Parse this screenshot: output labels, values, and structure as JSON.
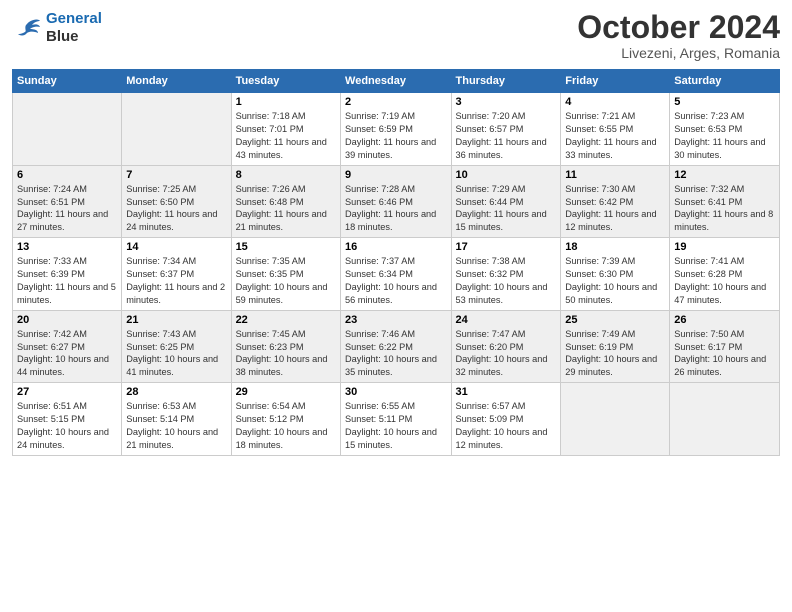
{
  "header": {
    "logo_line1": "General",
    "logo_line2": "Blue",
    "month": "October 2024",
    "location": "Livezeni, Arges, Romania"
  },
  "days_of_week": [
    "Sunday",
    "Monday",
    "Tuesday",
    "Wednesday",
    "Thursday",
    "Friday",
    "Saturday"
  ],
  "weeks": [
    [
      {
        "day": "",
        "info": ""
      },
      {
        "day": "",
        "info": ""
      },
      {
        "day": "1",
        "info": "Sunrise: 7:18 AM\nSunset: 7:01 PM\nDaylight: 11 hours and 43 minutes."
      },
      {
        "day": "2",
        "info": "Sunrise: 7:19 AM\nSunset: 6:59 PM\nDaylight: 11 hours and 39 minutes."
      },
      {
        "day": "3",
        "info": "Sunrise: 7:20 AM\nSunset: 6:57 PM\nDaylight: 11 hours and 36 minutes."
      },
      {
        "day": "4",
        "info": "Sunrise: 7:21 AM\nSunset: 6:55 PM\nDaylight: 11 hours and 33 minutes."
      },
      {
        "day": "5",
        "info": "Sunrise: 7:23 AM\nSunset: 6:53 PM\nDaylight: 11 hours and 30 minutes."
      }
    ],
    [
      {
        "day": "6",
        "info": "Sunrise: 7:24 AM\nSunset: 6:51 PM\nDaylight: 11 hours and 27 minutes."
      },
      {
        "day": "7",
        "info": "Sunrise: 7:25 AM\nSunset: 6:50 PM\nDaylight: 11 hours and 24 minutes."
      },
      {
        "day": "8",
        "info": "Sunrise: 7:26 AM\nSunset: 6:48 PM\nDaylight: 11 hours and 21 minutes."
      },
      {
        "day": "9",
        "info": "Sunrise: 7:28 AM\nSunset: 6:46 PM\nDaylight: 11 hours and 18 minutes."
      },
      {
        "day": "10",
        "info": "Sunrise: 7:29 AM\nSunset: 6:44 PM\nDaylight: 11 hours and 15 minutes."
      },
      {
        "day": "11",
        "info": "Sunrise: 7:30 AM\nSunset: 6:42 PM\nDaylight: 11 hours and 12 minutes."
      },
      {
        "day": "12",
        "info": "Sunrise: 7:32 AM\nSunset: 6:41 PM\nDaylight: 11 hours and 8 minutes."
      }
    ],
    [
      {
        "day": "13",
        "info": "Sunrise: 7:33 AM\nSunset: 6:39 PM\nDaylight: 11 hours and 5 minutes."
      },
      {
        "day": "14",
        "info": "Sunrise: 7:34 AM\nSunset: 6:37 PM\nDaylight: 11 hours and 2 minutes."
      },
      {
        "day": "15",
        "info": "Sunrise: 7:35 AM\nSunset: 6:35 PM\nDaylight: 10 hours and 59 minutes."
      },
      {
        "day": "16",
        "info": "Sunrise: 7:37 AM\nSunset: 6:34 PM\nDaylight: 10 hours and 56 minutes."
      },
      {
        "day": "17",
        "info": "Sunrise: 7:38 AM\nSunset: 6:32 PM\nDaylight: 10 hours and 53 minutes."
      },
      {
        "day": "18",
        "info": "Sunrise: 7:39 AM\nSunset: 6:30 PM\nDaylight: 10 hours and 50 minutes."
      },
      {
        "day": "19",
        "info": "Sunrise: 7:41 AM\nSunset: 6:28 PM\nDaylight: 10 hours and 47 minutes."
      }
    ],
    [
      {
        "day": "20",
        "info": "Sunrise: 7:42 AM\nSunset: 6:27 PM\nDaylight: 10 hours and 44 minutes."
      },
      {
        "day": "21",
        "info": "Sunrise: 7:43 AM\nSunset: 6:25 PM\nDaylight: 10 hours and 41 minutes."
      },
      {
        "day": "22",
        "info": "Sunrise: 7:45 AM\nSunset: 6:23 PM\nDaylight: 10 hours and 38 minutes."
      },
      {
        "day": "23",
        "info": "Sunrise: 7:46 AM\nSunset: 6:22 PM\nDaylight: 10 hours and 35 minutes."
      },
      {
        "day": "24",
        "info": "Sunrise: 7:47 AM\nSunset: 6:20 PM\nDaylight: 10 hours and 32 minutes."
      },
      {
        "day": "25",
        "info": "Sunrise: 7:49 AM\nSunset: 6:19 PM\nDaylight: 10 hours and 29 minutes."
      },
      {
        "day": "26",
        "info": "Sunrise: 7:50 AM\nSunset: 6:17 PM\nDaylight: 10 hours and 26 minutes."
      }
    ],
    [
      {
        "day": "27",
        "info": "Sunrise: 6:51 AM\nSunset: 5:15 PM\nDaylight: 10 hours and 24 minutes."
      },
      {
        "day": "28",
        "info": "Sunrise: 6:53 AM\nSunset: 5:14 PM\nDaylight: 10 hours and 21 minutes."
      },
      {
        "day": "29",
        "info": "Sunrise: 6:54 AM\nSunset: 5:12 PM\nDaylight: 10 hours and 18 minutes."
      },
      {
        "day": "30",
        "info": "Sunrise: 6:55 AM\nSunset: 5:11 PM\nDaylight: 10 hours and 15 minutes."
      },
      {
        "day": "31",
        "info": "Sunrise: 6:57 AM\nSunset: 5:09 PM\nDaylight: 10 hours and 12 minutes."
      },
      {
        "day": "",
        "info": ""
      },
      {
        "day": "",
        "info": ""
      }
    ]
  ]
}
